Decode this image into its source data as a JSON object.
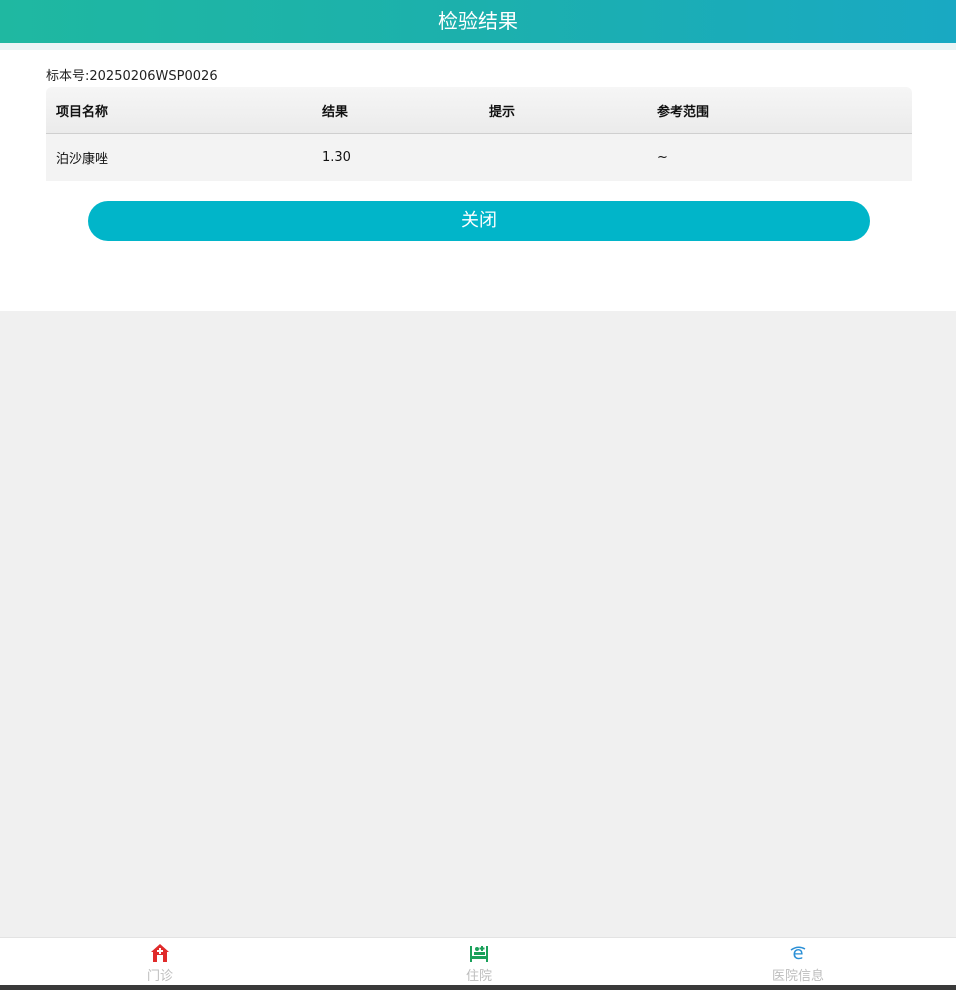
{
  "header": {
    "title": "检验结果"
  },
  "sample": {
    "label": "标本号:",
    "value": "20250206WSP0026"
  },
  "table": {
    "columns": [
      "项目名称",
      "结果",
      "提示",
      "参考范围"
    ],
    "rows": [
      {
        "name": "泊沙康唑",
        "result": "1.30",
        "hint": "",
        "range": "~"
      }
    ]
  },
  "close_button": {
    "label": "关闭"
  },
  "tabbar": {
    "items": [
      {
        "label": "门诊",
        "icon": "outpatient-icon",
        "color": "#e02b2b"
      },
      {
        "label": "住院",
        "icon": "inpatient-bed-icon",
        "color": "#1aa05a"
      },
      {
        "label": "医院信息",
        "icon": "hospital-info-icon",
        "color": "#2a8fd6"
      }
    ]
  },
  "colors": {
    "header_start": "#1fb8a1",
    "header_end": "#19a9c3",
    "button": "#01b5c9"
  }
}
